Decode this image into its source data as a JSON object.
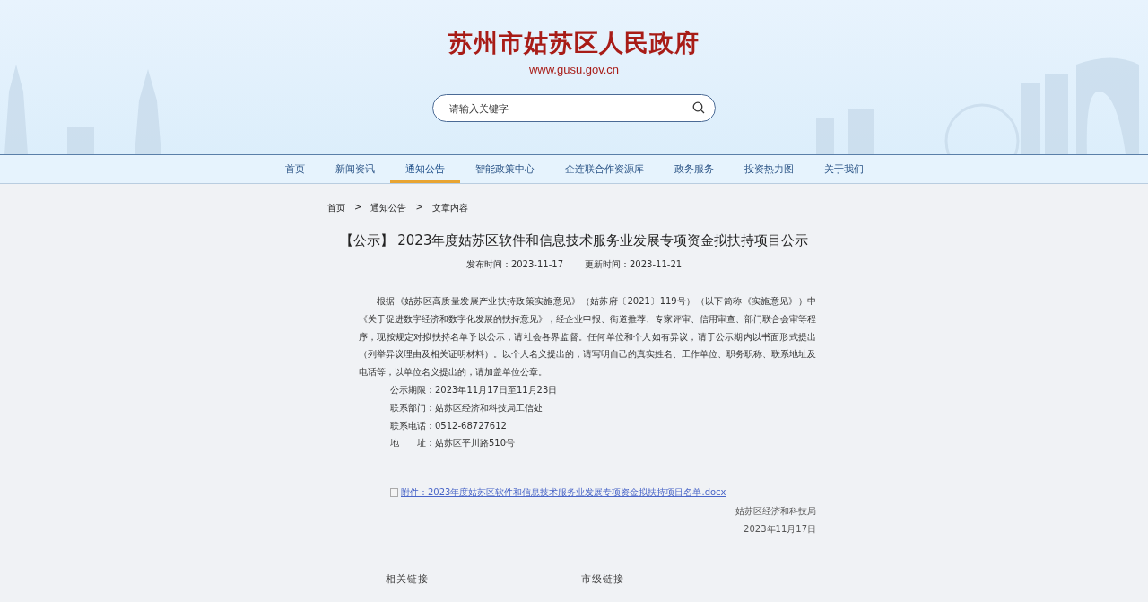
{
  "header": {
    "site_name": "苏州市姑苏区人民政府",
    "site_url": "www.gusu.gov.cn"
  },
  "search": {
    "placeholder": "请输入关键字"
  },
  "nav": [
    {
      "label": "首页",
      "selected": false
    },
    {
      "label": "新闻资讯",
      "selected": false
    },
    {
      "label": "通知公告",
      "selected": true
    },
    {
      "label": "智能政策中心",
      "selected": false
    },
    {
      "label": "企连联合作资源库",
      "selected": false
    },
    {
      "label": "政务服务",
      "selected": false
    },
    {
      "label": "投资热力图",
      "selected": false
    },
    {
      "label": "关于我们",
      "selected": false
    }
  ],
  "breadcrumb": [
    "首页",
    "通知公告",
    "文章内容"
  ],
  "breadcrumb_separator": ">",
  "article": {
    "title": "【公示】 2023年度姑苏区软件和信息技术服务业发展专项资金拟扶持项目公示",
    "published": "发布时间：2023-11-17",
    "updated": "更新时间：2023-11-21",
    "body": "根据《姑苏区高质量发展产业扶持政策实施意见》（姑苏府〔2021〕119号）（以下简称《实施意见》）中《关于促进数字经济和数字化发展的扶持意见》，经企业申报、街道推荐、专家评审、信用审查、部门联合会审等程序，现按规定对拟扶持名单予以公示，请社会各界监督。任何单位和个人如有异议，请于公示期内以书面形式提出（列举异议理由及相关证明材料）。以个人名义提出的，请写明自己的真实姓名、工作单位、职务职称、联系地址及电话等；以单位名义提出的，请加盖单位公章。",
    "details": [
      "公示期限：2023年11月17日至11月23日",
      "联系部门：姑苏区经济和科技局工信处",
      "联系电话：0512-68727612",
      "地　　址：姑苏区平川路510号"
    ],
    "attachment": "附件：2023年度姑苏区软件和信息技术服务业发展专项资金拟扶持项目名单.docx",
    "signature": "姑苏区经济和科技局",
    "date": "2023年11月17日"
  },
  "footer": {
    "headings": [
      "相关链接",
      "市级链接"
    ]
  }
}
